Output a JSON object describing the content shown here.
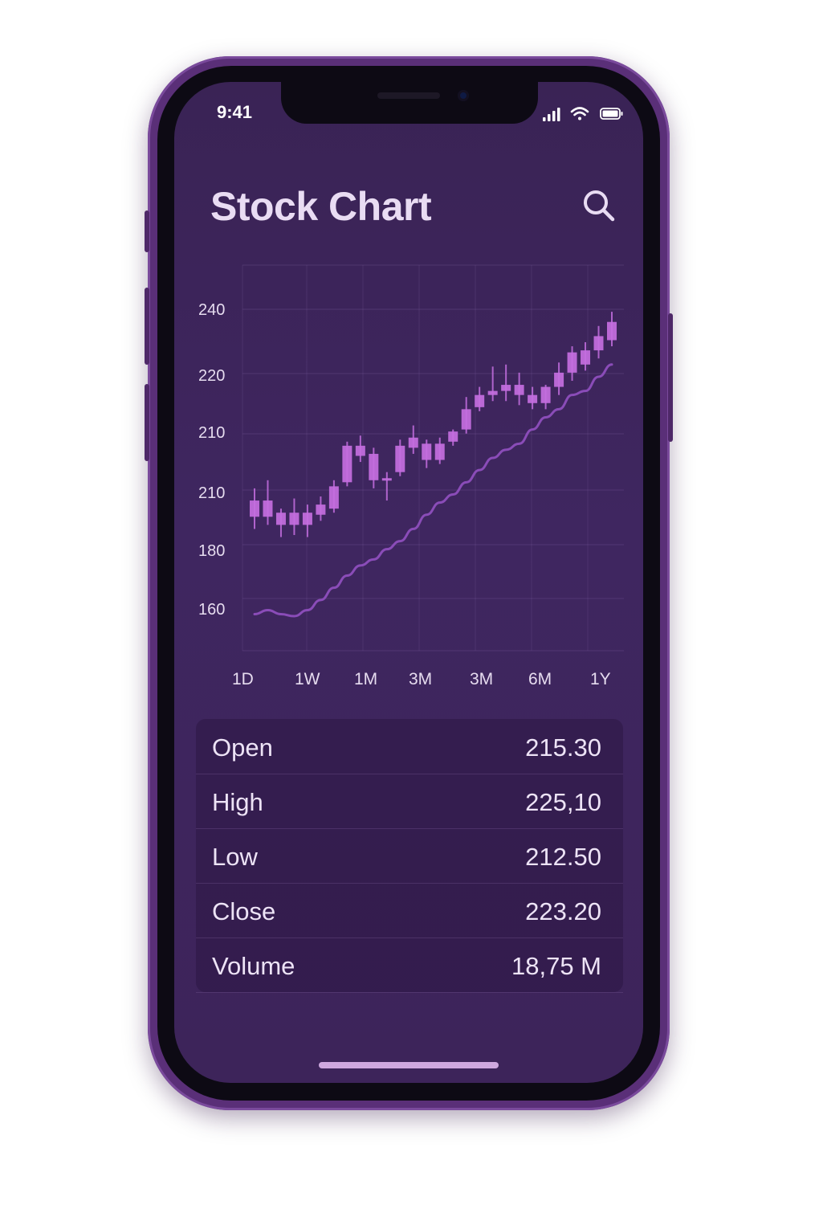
{
  "status_bar": {
    "time": "9:41"
  },
  "header": {
    "title": "Stock Chart",
    "search_icon": "search-icon"
  },
  "colors": {
    "background": "#3d245a",
    "candle": "#c46ee0",
    "line": "#8a4cb8",
    "text": "#e6dcef"
  },
  "chart_data": {
    "type": "candlestick",
    "y_tick_labels": [
      "240",
      "220",
      "210",
      "210",
      "180",
      "160"
    ],
    "candles": [
      {
        "open": 176,
        "close": 184,
        "high": 190,
        "low": 170
      },
      {
        "open": 184,
        "close": 176,
        "high": 194,
        "low": 172
      },
      {
        "open": 178,
        "close": 172,
        "high": 180,
        "low": 166
      },
      {
        "open": 172,
        "close": 178,
        "high": 185,
        "low": 167
      },
      {
        "open": 178,
        "close": 172,
        "high": 182,
        "low": 166
      },
      {
        "open": 177,
        "close": 182,
        "high": 186,
        "low": 174
      },
      {
        "open": 180,
        "close": 191,
        "high": 194,
        "low": 178
      },
      {
        "open": 193,
        "close": 211,
        "high": 213,
        "low": 191
      },
      {
        "open": 211,
        "close": 206,
        "high": 216,
        "low": 203
      },
      {
        "open": 207,
        "close": 194,
        "high": 210,
        "low": 190
      },
      {
        "open": 195,
        "close": 195,
        "high": 198,
        "low": 184
      },
      {
        "open": 198,
        "close": 211,
        "high": 214,
        "low": 196
      },
      {
        "open": 210,
        "close": 215,
        "high": 221,
        "low": 207
      },
      {
        "open": 212,
        "close": 204,
        "high": 214,
        "low": 200
      },
      {
        "open": 204,
        "close": 212,
        "high": 215,
        "low": 202
      },
      {
        "open": 213,
        "close": 218,
        "high": 219,
        "low": 211
      },
      {
        "open": 219,
        "close": 229,
        "high": 235,
        "low": 217
      },
      {
        "open": 230,
        "close": 236,
        "high": 240,
        "low": 228
      },
      {
        "open": 236,
        "close": 238,
        "high": 250,
        "low": 233
      },
      {
        "open": 238,
        "close": 241,
        "high": 251,
        "low": 233
      },
      {
        "open": 241,
        "close": 236,
        "high": 247,
        "low": 231
      },
      {
        "open": 236,
        "close": 232,
        "high": 240,
        "low": 229
      },
      {
        "open": 232,
        "close": 240,
        "high": 241,
        "low": 229
      },
      {
        "open": 240,
        "close": 247,
        "high": 252,
        "low": 236
      },
      {
        "open": 247,
        "close": 257,
        "high": 260,
        "low": 243
      },
      {
        "open": 251,
        "close": 258,
        "high": 262,
        "low": 248
      },
      {
        "open": 258,
        "close": 265,
        "high": 270,
        "low": 254
      },
      {
        "open": 263,
        "close": 272,
        "high": 277,
        "low": 260
      }
    ],
    "line": [
      128,
      130,
      128,
      127,
      130,
      135,
      141,
      147,
      152,
      155,
      160,
      164,
      170,
      177,
      183,
      187,
      193,
      199,
      205,
      209,
      212,
      219,
      225,
      229,
      236,
      238,
      245,
      251
    ],
    "ylim": [
      110,
      300
    ],
    "grid": true
  },
  "range_tabs": [
    "1D",
    "1W",
    "1M",
    "3M",
    "3M",
    "6M",
    "1Y"
  ],
  "stats": [
    {
      "label": "Open",
      "value": "215.30"
    },
    {
      "label": "High",
      "value": "225,10"
    },
    {
      "label": "Low",
      "value": "212.50"
    },
    {
      "label": "Close",
      "value": "223.20"
    },
    {
      "label": "Volume",
      "value": "18,75  M"
    }
  ]
}
